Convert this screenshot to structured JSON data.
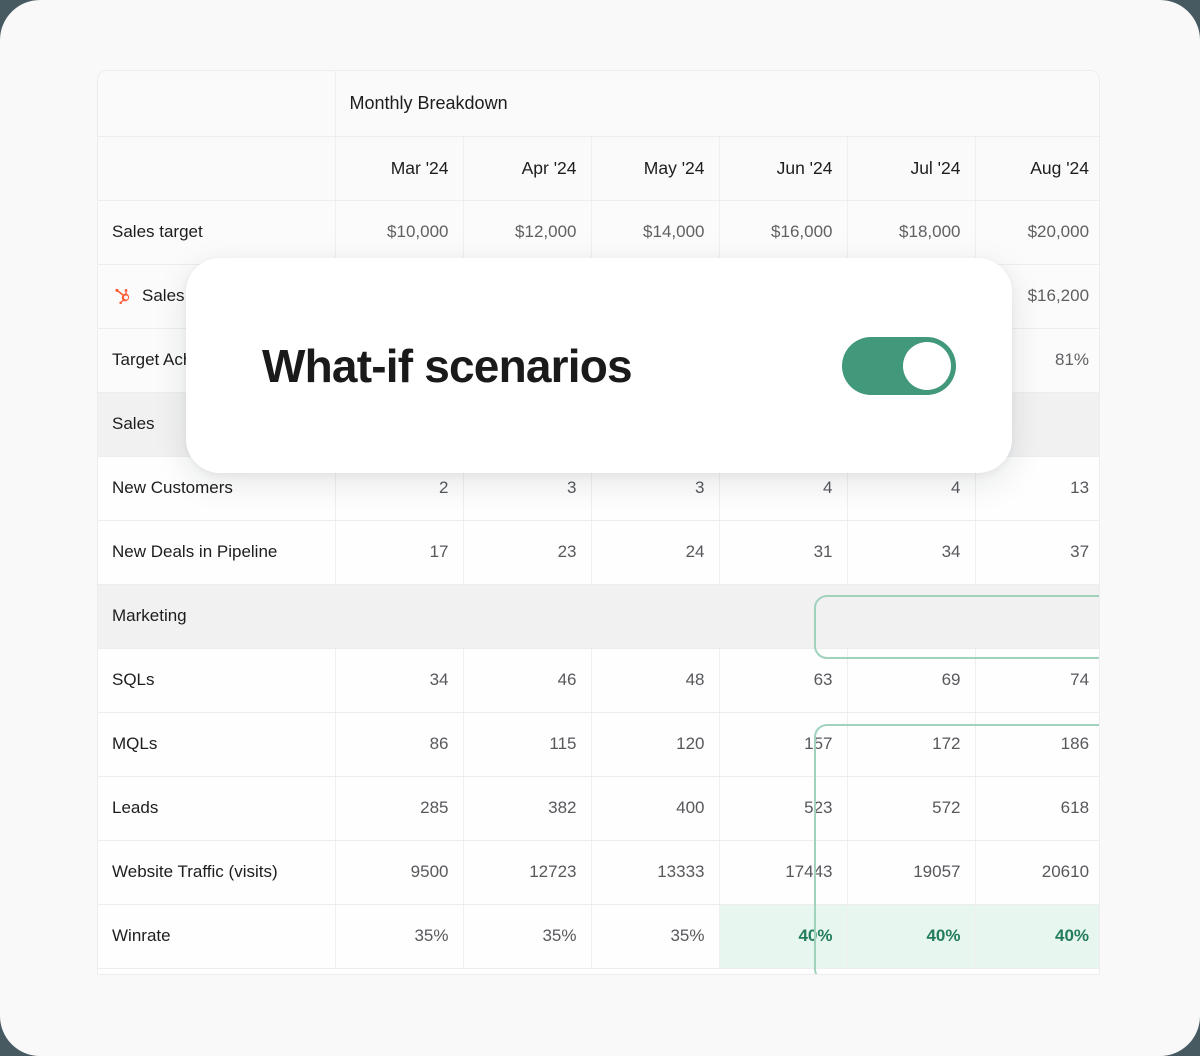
{
  "theme": {
    "page_background": "#475A62",
    "stage_background": "#F9F9FA",
    "accent_green": "#41987A",
    "projected_text_green": "#1F7A5B",
    "selection_soft_border": "#A0D2BC",
    "selection_strong_border": "#3E9575",
    "selection_fill": "#E7F6EF",
    "hubspot_orange": "#FF5C35"
  },
  "overlay_card": {
    "title": "What-if scenarios",
    "toggle": {
      "name": "what-if-scenarios-toggle",
      "state": "on",
      "state_label": "On"
    }
  },
  "table": {
    "group_title": "Monthly Breakdown",
    "row_label_header": "",
    "columns": [
      "Mar '24",
      "Apr '24",
      "May '24",
      "Jun '24",
      "Jul '24",
      "Aug '24"
    ],
    "rows": [
      {
        "label": "Sales target",
        "icon": null,
        "type": "data",
        "values": [
          "$10,000",
          "$12,000",
          "$14,000",
          "$16,000",
          "$18,000",
          "$20,000"
        ],
        "projected_from": null
      },
      {
        "label": "Sales actual",
        "icon": "hubspot-icon",
        "type": "data",
        "values": [
          "",
          "",
          "",
          "",
          "",
          "$16,200"
        ],
        "projected_from": null
      },
      {
        "label": "Target Achievement",
        "icon": null,
        "type": "data",
        "values": [
          "",
          "",
          "",
          "",
          "",
          "81%"
        ],
        "projected_from": null
      },
      {
        "label": "Sales",
        "type": "section"
      },
      {
        "label": "New Customers",
        "icon": null,
        "type": "data",
        "values": [
          "2",
          "3",
          "3",
          "4",
          "4",
          "13"
        ],
        "projected_from": null
      },
      {
        "label": "New Deals in Pipeline",
        "icon": null,
        "type": "data",
        "values": [
          "17",
          "23",
          "24",
          "31",
          "34",
          "37"
        ],
        "projected_from": 5
      },
      {
        "label": "Marketing",
        "type": "section"
      },
      {
        "label": "SQLs",
        "icon": null,
        "type": "data",
        "values": [
          "34",
          "46",
          "48",
          "63",
          "69",
          "74"
        ],
        "projected_from": 3
      },
      {
        "label": "MQLs",
        "icon": null,
        "type": "data",
        "values": [
          "86",
          "115",
          "120",
          "157",
          "172",
          "186"
        ],
        "projected_from": 3
      },
      {
        "label": "Leads",
        "icon": null,
        "type": "data",
        "values": [
          "285",
          "382",
          "400",
          "523",
          "572",
          "618"
        ],
        "projected_from": 3
      },
      {
        "label": "Website Traffic (visits)",
        "icon": null,
        "type": "data",
        "values": [
          "9500",
          "12723",
          "13333",
          "17443",
          "19057",
          "20610"
        ],
        "projected_from": 3
      },
      {
        "label": "Winrate",
        "icon": null,
        "type": "data",
        "highlight": "strong",
        "values": [
          "35%",
          "35%",
          "35%",
          "40%",
          "40%",
          "40%"
        ],
        "projected_from": 3
      }
    ],
    "selections": [
      {
        "name": "selection-new-deals-in-pipeline",
        "style": "soft",
        "rows": [
          "New Deals in Pipeline"
        ],
        "columns": [
          "Jun '24",
          "Jul '24",
          "Aug '24"
        ]
      },
      {
        "name": "selection-marketing-block",
        "style": "soft",
        "rows": [
          "SQLs",
          "MQLs",
          "Leads",
          "Website Traffic (visits)"
        ],
        "columns": [
          "Jun '24",
          "Jul '24",
          "Aug '24"
        ]
      },
      {
        "name": "selection-winrate",
        "style": "strong",
        "rows": [
          "Winrate"
        ],
        "columns": [
          "Jun '24",
          "Jul '24",
          "Aug '24"
        ]
      }
    ]
  }
}
